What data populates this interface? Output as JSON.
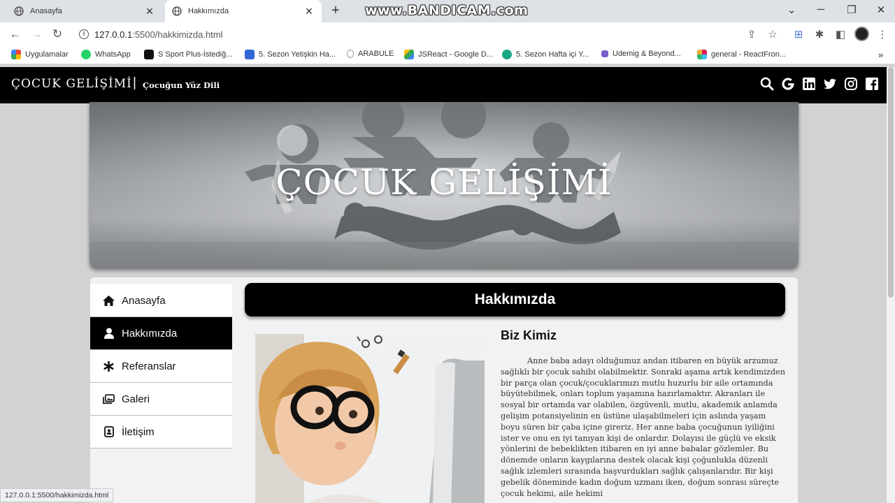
{
  "browser": {
    "tabs": [
      {
        "label": "Anasayfa",
        "active": false
      },
      {
        "label": "Hakkımızda",
        "active": true
      }
    ],
    "watermark": "www.BANDICAM.com",
    "url_host": "127.0.0.1",
    "url_rest": ":5500/hakkimizda.html",
    "bookmarks": [
      {
        "label": "Uygulamalar",
        "icon": "apps-grid-icon",
        "color": "#4285f4"
      },
      {
        "label": "WhatsApp",
        "icon": "whatsapp-icon",
        "color": "#25d366"
      },
      {
        "label": "S Sport Plus-İstediğ...",
        "icon": "ssport-icon",
        "color": "#111111"
      },
      {
        "label": "5. Sezon Yetişkin Ha...",
        "icon": "classroom-icon",
        "color": "#3367d6"
      },
      {
        "label": "ARABULE",
        "icon": "arabule-icon",
        "color": "#555555"
      },
      {
        "label": "JSReact - Google D...",
        "icon": "google-drive-icon",
        "color": "#fbbc04"
      },
      {
        "label": "5. Sezon Hafta içi Y...",
        "icon": "meet-icon",
        "color": "#1ba784"
      },
      {
        "label": "Udemig & Beyond...",
        "icon": "udemig-icon",
        "color": "#7b61c9"
      },
      {
        "label": "general - ReactFron...",
        "icon": "slack-icon",
        "color": "#e01e5a"
      }
    ],
    "status_url": "127.0.0.1:5500/hakkimizda.html"
  },
  "site": {
    "brand": "ÇOCUK GELİŞİMİ",
    "separator": "|",
    "slogan": "Çocuğun Yüz Dili",
    "social_icons": [
      "search-icon",
      "google-icon",
      "linkedin-icon",
      "twitter-icon",
      "instagram-icon",
      "facebook-icon"
    ],
    "hero_title": "ÇOCUK GELİŞİMİ"
  },
  "sidebar": {
    "items": [
      {
        "label": "Anasayfa",
        "icon": "home-icon",
        "active": false
      },
      {
        "label": "Hakkımızda",
        "icon": "user-icon",
        "active": true
      },
      {
        "label": "Referanslar",
        "icon": "asterisk-icon",
        "active": false
      },
      {
        "label": "Galeri",
        "icon": "images-icon",
        "active": false
      },
      {
        "label": "İletişim",
        "icon": "contact-card-icon",
        "active": false
      }
    ]
  },
  "main": {
    "title": "Hakkımızda",
    "subheading": "Biz Kimiz",
    "paragraph": "Anne baba adayı olduğumuz andan itibaren en büyük arzumuz sağlıklı bir çocuk sahibi olabilmektir. Sonraki aşama artık kendimizden bir parça olan çocuk/çocuklarımızı mutlu huzurlu bir aile ortamında büyütebilmek, onları toplum yaşamına hazırlamaktır. Akranları ile sosyal bir ortamda var olabilen, özgüvenli, mutlu, akademik anlamda gelişim potansiyelinin en üstüne ulaşabilmeleri için aslında yaşam boyu süren bir çaba içine gireriz. Her anne baba çocuğunun iyiliğini ister ve onu en iyi tanıyan kişi de onlardır. Dolayısı ile güçlü ve eksik yönlerini de bebeklikten itibaren en iyi anne babalar gözlemler. Bu dönemde onların kaygılarına destek olacak kişi çoğunlukla düzenli sağlık izlemleri sırasında başvurdukları sağlık çalışanlarıdır. Bir kişi gebelik döneminde kadın doğum uzmanı iken, doğum sonrası süreçte çocuk hekimi, aile hekimi"
  }
}
